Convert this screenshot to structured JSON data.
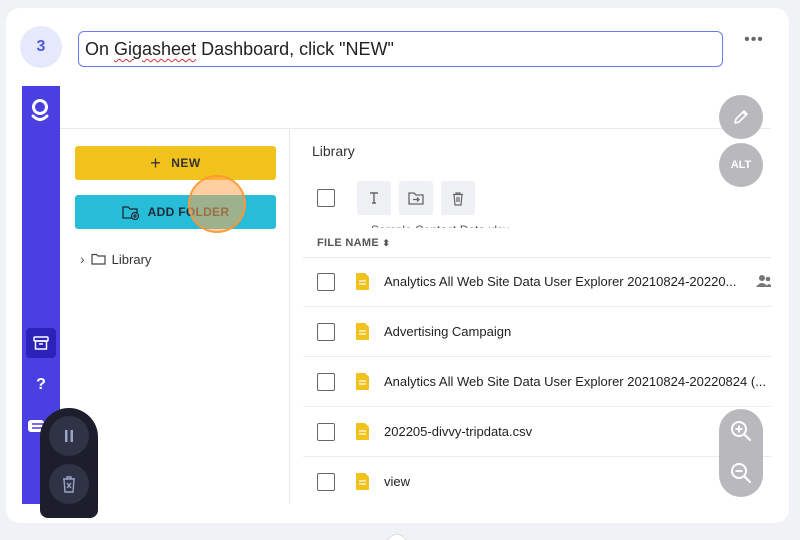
{
  "step": {
    "number": "3",
    "instruction_word_1": "On ",
    "instruction_word_2": "Gigasheet",
    "instruction_rest": " Dashboard, click \"NEW\"",
    "more_label": "•••"
  },
  "sidebar": {
    "help_label": "?"
  },
  "left_panel": {
    "new_button": {
      "plus": "+",
      "label": "NEW"
    },
    "add_folder_button": {
      "label": "ADD FOLDER"
    },
    "tree": {
      "chevron": "›",
      "label": "Library"
    }
  },
  "library": {
    "title": "Library",
    "ghost_row_label": "Sample Contact Data.xlsx",
    "column_header": "FILE NAME",
    "sort_glyph": "⬍",
    "files": [
      {
        "name": "Analytics All Web Site Data User Explorer 20210824-20220...",
        "shared": true
      },
      {
        "name": "Advertising Campaign",
        "shared": false
      },
      {
        "name": "Analytics All Web Site Data User Explorer 20210824-20220824 (...",
        "shared": false
      },
      {
        "name": "202205-divvy-tripdata.csv",
        "shared": false
      },
      {
        "name": "view",
        "shared": false
      }
    ]
  },
  "overlay": {
    "alt_label": "ALT"
  },
  "colors": {
    "rail": "#4a3fe0",
    "new_button": "#f1c21b",
    "add_folder_button": "#27bcd8",
    "file_icon": "#f1c21b",
    "step_accent": "#4f5bd5"
  }
}
